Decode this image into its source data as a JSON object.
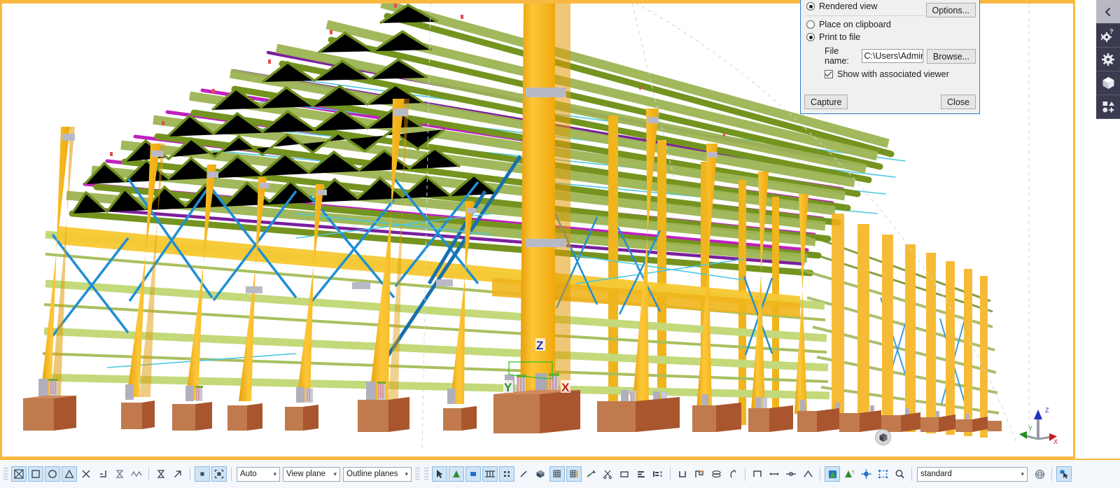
{
  "app": {
    "viewport_name": "3d-model-view",
    "accent_frame_color": "#f9b83f",
    "background_color": "#ffffff"
  },
  "capture_dialog": {
    "title": "Print to file",
    "options_button": "Options...",
    "radio_rendered_view": "Rendered view",
    "radio_place_on_clipboard": "Place on clipboard",
    "radio_print_to_file": "Print to file",
    "selected_output": "Print to file",
    "selected_render": "Rendered view",
    "file_name_label": "File name:",
    "file_name_value": "C:\\Users\\Administr",
    "browse_button": "Browse...",
    "show_viewer_label": "Show with associated viewer",
    "show_viewer_checked": true,
    "capture_button": "Capture",
    "close_button": "Close",
    "border_color": "#2a7fd4"
  },
  "right_rail": {
    "items": [
      {
        "name": "collapse-panel",
        "icon": "chevron-left-icon",
        "label": ""
      },
      {
        "name": "help-settings",
        "icon": "gear-question-icon",
        "label": ""
      },
      {
        "name": "settings",
        "icon": "gear-icon",
        "label": ""
      },
      {
        "name": "components",
        "icon": "cube-icon",
        "label": ""
      },
      {
        "name": "shapes-catalog",
        "icon": "shapes-icon",
        "label": ""
      }
    ]
  },
  "bottom_toolbar": {
    "snap_group": [
      {
        "name": "snap-to-any-position",
        "icon": "boxed-x-icon",
        "active": true
      },
      {
        "name": "snap-to-points",
        "icon": "square-icon",
        "active": true
      },
      {
        "name": "snap-to-centers",
        "icon": "circle-icon",
        "active": true
      },
      {
        "name": "snap-to-midpoints",
        "icon": "triangle-icon",
        "active": true
      },
      {
        "name": "snap-to-intersections",
        "icon": "x-cross-icon",
        "active": false
      },
      {
        "name": "snap-to-perpendicular",
        "icon": "corner-icon",
        "active": false
      },
      {
        "name": "snap-to-lines",
        "icon": "hourglass-icon",
        "active": false
      },
      {
        "name": "snap-to-nearest",
        "icon": "wave-icon",
        "active": false
      }
    ],
    "snap_group2": [
      {
        "name": "snap-to-geometry-lines",
        "icon": "hourglass-icon",
        "active": false
      },
      {
        "name": "snap-to-extension",
        "icon": "arrow-up-right-icon",
        "active": false
      }
    ],
    "snap_group3": [
      {
        "name": "snap-override-point",
        "icon": "filled-square-icon",
        "active": true
      },
      {
        "name": "snap-override-shape",
        "icon": "bracket-square-icon",
        "active": true
      }
    ],
    "combo_depth": {
      "name": "snap-depth-select",
      "value": "Auto"
    },
    "combo_plane": {
      "name": "work-plane-select",
      "value": "View plane"
    },
    "combo_outline": {
      "name": "outline-planes-select",
      "value": "Outline planes"
    },
    "tools_group": [
      {
        "name": "select-arrow",
        "icon": "cursor-icon",
        "active": true
      },
      {
        "name": "select-component",
        "icon": "green-triangle-icon",
        "active": true
      },
      {
        "name": "select-part",
        "icon": "blue-square-icon",
        "active": true
      },
      {
        "name": "select-assembly",
        "icon": "assembly-icon",
        "active": true
      },
      {
        "name": "select-object-group",
        "icon": "four-dots-icon",
        "active": true
      },
      {
        "name": "select-line",
        "icon": "diagonal-line-icon",
        "active": false
      },
      {
        "name": "select-solid",
        "icon": "cube-solid-icon",
        "active": false
      },
      {
        "name": "select-grid",
        "icon": "grid-icon",
        "active": true
      },
      {
        "name": "select-grid-line",
        "icon": "grid-line-icon",
        "active": true
      },
      {
        "name": "select-weld",
        "icon": "weld-icon",
        "active": false
      },
      {
        "name": "select-cut",
        "icon": "scissors-icon",
        "active": false
      },
      {
        "name": "select-surface",
        "icon": "rect-outline-icon",
        "active": false
      },
      {
        "name": "select-load",
        "icon": "load-icon",
        "active": false
      },
      {
        "name": "select-reference",
        "icon": "reference-icon",
        "active": false
      },
      {
        "name": "select-bolt",
        "icon": "u-shape-icon",
        "active": false
      },
      {
        "name": "select-rebar",
        "icon": "rebar-icon",
        "active": false
      },
      {
        "name": "select-pour",
        "icon": "pour-icon",
        "active": false
      },
      {
        "name": "select-pour-break",
        "icon": "pour-break-icon",
        "active": false
      }
    ],
    "tools_group2": [
      {
        "name": "select-connection",
        "icon": "omega-icon",
        "active": false
      },
      {
        "name": "select-distance",
        "icon": "distance-icon",
        "active": false
      },
      {
        "name": "select-handle",
        "icon": "handle-icon",
        "active": false
      },
      {
        "name": "select-chamfer",
        "icon": "chamfer-icon",
        "active": false
      }
    ],
    "tools_group3": [
      {
        "name": "render-settings",
        "icon": "render-icon",
        "active": true
      },
      {
        "name": "component-visibility",
        "icon": "green-flag-icon",
        "active": false
      },
      {
        "name": "point-visibility",
        "icon": "blue-node-icon",
        "active": false
      },
      {
        "name": "reference-visibility",
        "icon": "dashed-box-icon",
        "active": false
      },
      {
        "name": "zoom-tool",
        "icon": "magnifier-icon",
        "active": false
      }
    ],
    "combo_standard": {
      "name": "settings-preset-select",
      "value": "standard"
    },
    "end_group": [
      {
        "name": "color-wheel",
        "icon": "sphere-grid-icon",
        "active": false
      },
      {
        "name": "pick-selection",
        "icon": "pick-cursor-icon",
        "active": true
      }
    ]
  },
  "viewport_overlays": {
    "axis_labels": [
      {
        "name": "axis-label-x",
        "text": "X",
        "color": "#c02020"
      },
      {
        "name": "axis-label-y",
        "text": "Y",
        "color": "#1f8f1f"
      },
      {
        "name": "axis-label-z",
        "text": "Z",
        "color": "#2030c0"
      }
    ],
    "triad_labels": [
      {
        "name": "triad-label-x",
        "text": "X",
        "color": "#c02020"
      },
      {
        "name": "triad-label-y",
        "text": "Y",
        "color": "#1f8f1f"
      },
      {
        "name": "triad-label-z",
        "text": "Z",
        "color": "#2030c0"
      }
    ],
    "nav_cube": {
      "name": "navigation-cube-button",
      "icon": "cube-icon"
    }
  },
  "model": {
    "description": "Steel portal frame warehouse structure, rendered 3D view",
    "colors": {
      "column": "#f5b014",
      "column_light": "#fcc739",
      "truss": "#6f8f1e",
      "truss_dark": "#56761a",
      "beam_light": "#c3d97a",
      "purlin_magenta": "#c020c0",
      "purlin_purple": "#7a1f9e",
      "brace_blue": "#1f8fd4",
      "brace_cyan": "#49c8e0",
      "footing": "#b5653a",
      "footing_light": "#c87a4c",
      "connection_gray": "#b8b8c4",
      "bolt_red": "#e05050"
    },
    "bays": 22,
    "frames": 9
  }
}
